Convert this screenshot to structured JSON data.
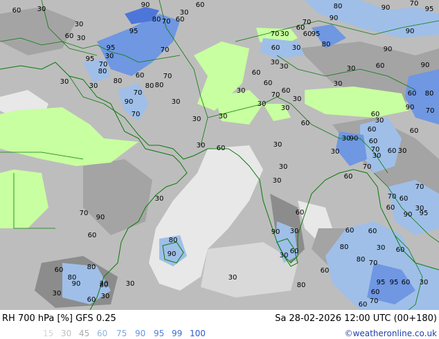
{
  "footer": {
    "title": "RH 700 hPa [%] GFS 0.25",
    "datetime": "Sa 28-02-2026 12:00 UTC (00+180)",
    "credit": "©weatheronline.co.uk"
  },
  "scale": [
    {
      "label": "15",
      "color": "#d6d6d6"
    },
    {
      "label": "30",
      "color": "#bfbfbf"
    },
    {
      "label": "45",
      "color": "#a8a8a8"
    },
    {
      "label": "60",
      "color": "#8fb6dc"
    },
    {
      "label": "75",
      "color": "#7aa6e0"
    },
    {
      "label": "90",
      "color": "#6494e6"
    },
    {
      "label": "95",
      "color": "#4c7fe0"
    },
    {
      "label": "99",
      "color": "#3b6ad6"
    },
    {
      "label": "100",
      "color": "#2c58c8"
    }
  ],
  "map": {
    "colors": {
      "dry": "#c8ffa0",
      "base": "#bdbdbd",
      "light": "#e8e8e8",
      "mid": "#a4a4a4",
      "dark": "#8c8c8c",
      "blue_light": "#9fbfe8",
      "blue": "#6f97e2",
      "blue_dark": "#4c77d8",
      "coast": "#0a7a0a",
      "border": "#0a7a0a"
    },
    "contour_labels": [
      "60",
      "30",
      "90",
      "60",
      "30",
      "80",
      "90",
      "70",
      "95",
      "90",
      "80",
      "60",
      "70",
      "30",
      "60",
      "70",
      "95",
      "60",
      "30",
      "70",
      "95",
      "60",
      "30",
      "90",
      "95",
      "70",
      "80",
      "60",
      "30",
      "90",
      "95",
      "30",
      "70",
      "30",
      "90",
      "80",
      "60",
      "70",
      "60",
      "30",
      "30",
      "30",
      "70",
      "80",
      "60",
      "80",
      "80",
      "30",
      "60",
      "70",
      "30",
      "30",
      "90",
      "60",
      "30",
      "30",
      "30",
      "30",
      "60",
      "80",
      "90",
      "70",
      "70",
      "60",
      "30",
      "30",
      "60",
      "30",
      "30",
      "60",
      "30",
      "60",
      "60",
      "60",
      "30",
      "90",
      "70",
      "30",
      "30",
      "30",
      "60",
      "30",
      "70",
      "60",
      "70",
      "30",
      "30",
      "70",
      "60",
      "30",
      "60",
      "90",
      "70",
      "60",
      "90",
      "95",
      "90",
      "60",
      "30",
      "60",
      "60",
      "30",
      "60",
      "80",
      "30",
      "60",
      "80",
      "60",
      "80",
      "70",
      "80",
      "60",
      "30",
      "95",
      "95",
      "60",
      "90",
      "30",
      "80",
      "80",
      "30",
      "30",
      "30",
      "60",
      "60",
      "70",
      "60",
      "30",
      "80",
      "90"
    ]
  }
}
